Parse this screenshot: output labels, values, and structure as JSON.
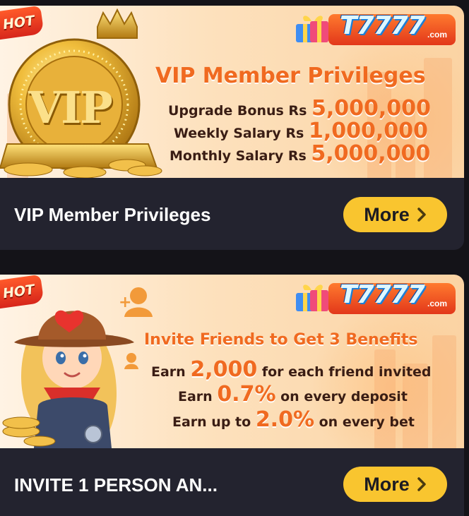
{
  "cards": [
    {
      "badge": "HOT",
      "brand": {
        "name": "T7777",
        "suffix": ".com"
      },
      "banner_title": "VIP Member Privileges",
      "coin_label": "VIP",
      "lines": [
        {
          "prefix": "Upgrade Bonus Rs ",
          "highlight": "5,000,000",
          "suffix": ""
        },
        {
          "prefix": "Weekly Salary Rs ",
          "highlight": "1,000,000",
          "suffix": ""
        },
        {
          "prefix": "Monthly Salary Rs ",
          "highlight": "5,000,000",
          "suffix": ""
        }
      ],
      "caption": "VIP Member Privileges",
      "button_label": "More"
    },
    {
      "badge": "HOT",
      "brand": {
        "name": "T7777",
        "suffix": ".com"
      },
      "banner_title": "Invite Friends to Get 3 Benefits",
      "lines": [
        {
          "prefix": "Earn ",
          "highlight": "2,000",
          "suffix": " for each friend invited"
        },
        {
          "prefix": "Earn ",
          "highlight": "0.7%",
          "suffix": " on every deposit"
        },
        {
          "prefix": "Earn up to ",
          "highlight": "2.0%",
          "suffix": " on every bet"
        }
      ],
      "caption": "INVITE 1 PERSON AN...",
      "button_label": "More"
    }
  ],
  "colors": {
    "button": "#f9c52f",
    "card_bg": "#23232f",
    "page_bg": "#141318",
    "accent_orange": "#f06a20"
  }
}
